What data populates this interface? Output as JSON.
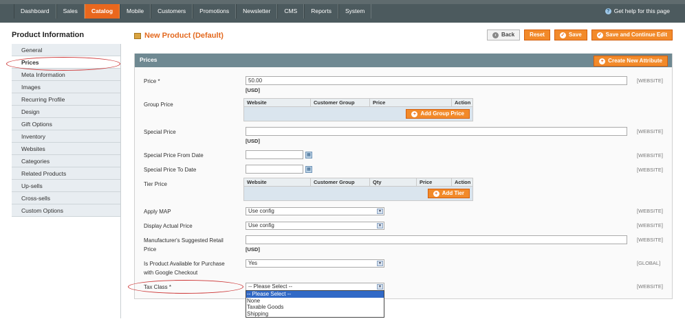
{
  "nav": {
    "items": [
      "Dashboard",
      "Sales",
      "Catalog",
      "Mobile",
      "Customers",
      "Promotions",
      "Newsletter",
      "CMS",
      "Reports",
      "System"
    ],
    "active": "Catalog",
    "help": "Get help for this page"
  },
  "sidebar": {
    "title": "Product Information",
    "tabs": [
      "General",
      "Prices",
      "Meta Information",
      "Images",
      "Recurring Profile",
      "Design",
      "Gift Options",
      "Inventory",
      "Websites",
      "Categories",
      "Related Products",
      "Up-sells",
      "Cross-sells",
      "Custom Options"
    ],
    "active": "Prices"
  },
  "header": {
    "title": "New Product (Default)",
    "back": "Back",
    "reset": "Reset",
    "save": "Save",
    "save_continue": "Save and Continue Edit"
  },
  "panel": {
    "title": "Prices",
    "create_attr": "Create New Attribute"
  },
  "form": {
    "price_label": "Price *",
    "price_value": "50.00",
    "currency": "[USD]",
    "group_price_label": "Group Price",
    "group_cols": [
      "Website",
      "Customer Group",
      "Price",
      "Action"
    ],
    "add_group_price": "Add Group Price",
    "special_price_label": "Special Price",
    "special_from_label": "Special Price From Date",
    "special_to_label": "Special Price To Date",
    "tier_price_label": "Tier Price",
    "tier_cols": [
      "Website",
      "Customer Group",
      "Qty",
      "Price",
      "Action"
    ],
    "add_tier": "Add Tier",
    "apply_map_label": "Apply MAP",
    "apply_map_value": "Use config",
    "display_actual_label": "Display Actual Price",
    "display_actual_value": "Use config",
    "msrp_label_1": "Manufacturer's Suggested Retail",
    "msrp_label_2": "Price",
    "google_label_1": "Is Product Available for Purchase",
    "google_label_2": "with Google Checkout",
    "google_value": "Yes",
    "tax_class_label": "Tax Class *",
    "tax_class_value": "-- Please Select --",
    "tax_options": [
      "-- Please Select --",
      "None",
      "Taxable Goods",
      "Shipping"
    ],
    "scope_website": "[WEBSITE]",
    "scope_global": "[GLOBAL]"
  },
  "colors": {
    "accent": "#e9671d",
    "nav": "#4c5a5e",
    "panel_head": "#6f8992"
  }
}
